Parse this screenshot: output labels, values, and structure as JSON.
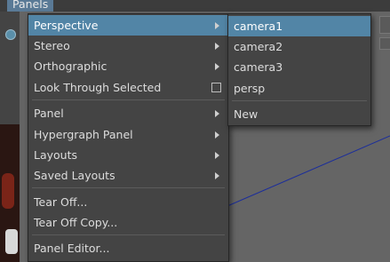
{
  "menubar": {
    "panels_label": "Panels"
  },
  "main_menu": {
    "items": [
      {
        "label": "Perspective",
        "submenu": true,
        "highlighted": true
      },
      {
        "label": "Stereo",
        "submenu": true
      },
      {
        "label": "Orthographic",
        "submenu": true
      },
      {
        "label": "Look Through Selected",
        "checkbox": true
      },
      {
        "label": "Panel",
        "submenu": true
      },
      {
        "label": "Hypergraph Panel",
        "submenu": true
      },
      {
        "label": "Layouts",
        "submenu": true
      },
      {
        "label": "Saved Layouts",
        "submenu": true
      },
      {
        "label": "Tear Off..."
      },
      {
        "label": "Tear Off Copy..."
      },
      {
        "label": "Panel Editor..."
      }
    ]
  },
  "perspective_submenu": {
    "items": [
      {
        "label": "camera1",
        "highlighted": true
      },
      {
        "label": "camera2"
      },
      {
        "label": "camera3"
      },
      {
        "label": "persp"
      },
      {
        "label": "New"
      }
    ]
  },
  "colors": {
    "menu_background": "#444444",
    "highlight": "#5285a6",
    "viewport": "#656565",
    "text": "#dddddd"
  }
}
